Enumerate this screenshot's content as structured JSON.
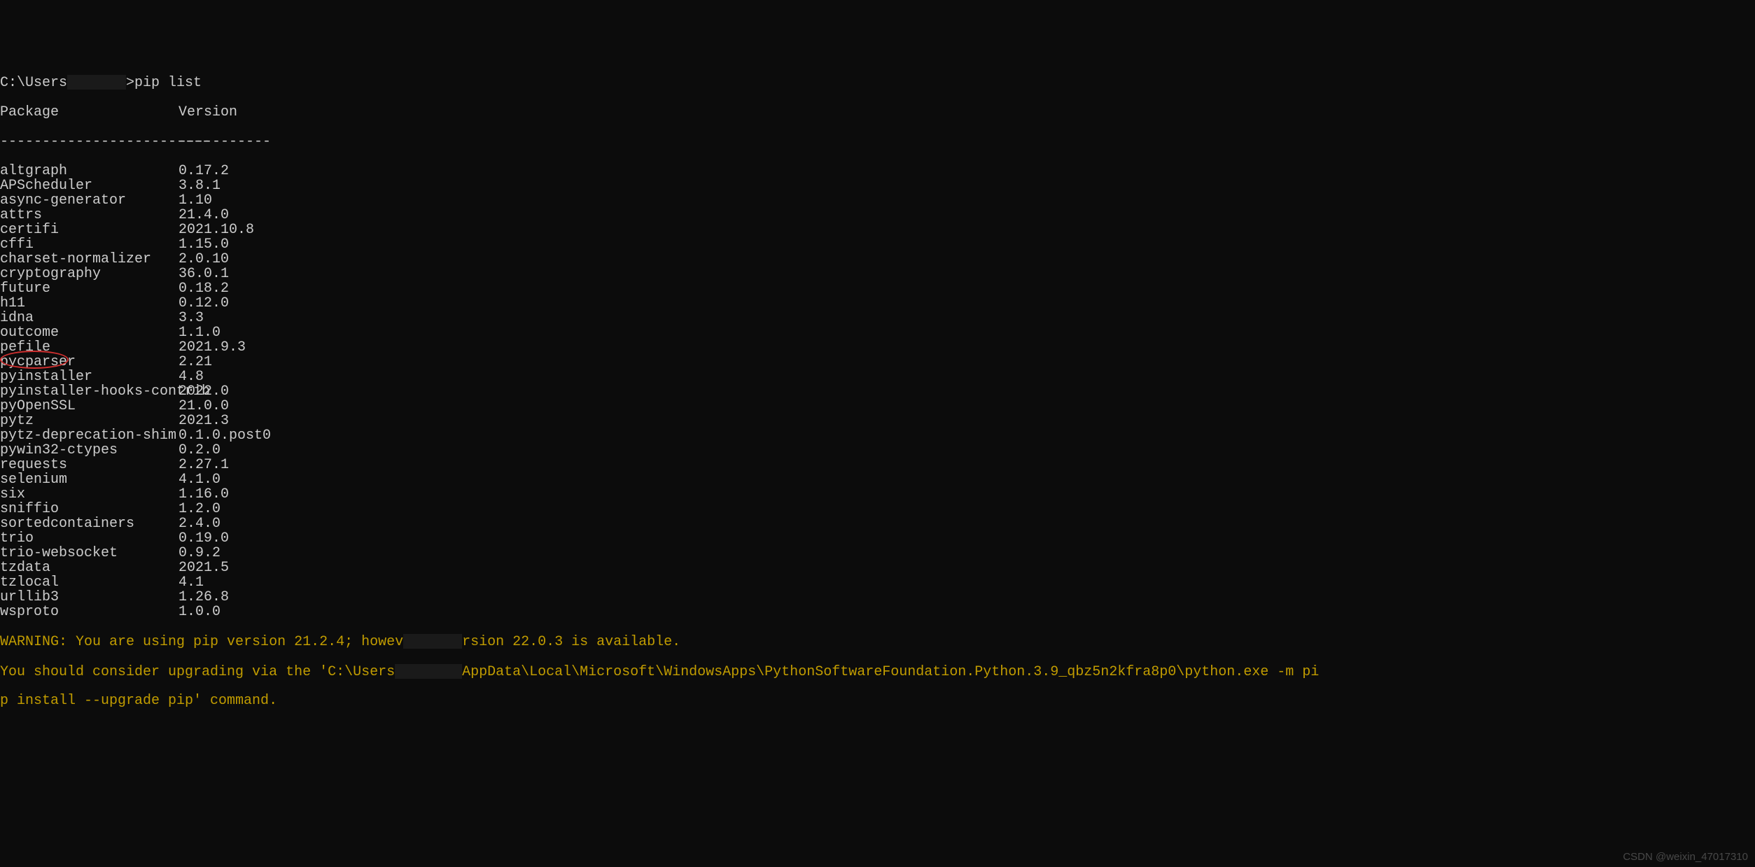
{
  "prompt": {
    "prefix": "C:\\Users",
    "redacted": "       ",
    "suffix": ">pip list"
  },
  "header": {
    "package": "Package",
    "version": "Version"
  },
  "divider": {
    "left": "-------------------------",
    "right": "-----------"
  },
  "packages": [
    {
      "name": "altgraph",
      "version": "0.17.2"
    },
    {
      "name": "APScheduler",
      "version": "3.8.1"
    },
    {
      "name": "async-generator",
      "version": "1.10"
    },
    {
      "name": "attrs",
      "version": "21.4.0"
    },
    {
      "name": "certifi",
      "version": "2021.10.8"
    },
    {
      "name": "cffi",
      "version": "1.15.0"
    },
    {
      "name": "charset-normalizer",
      "version": "2.0.10"
    },
    {
      "name": "cryptography",
      "version": "36.0.1"
    },
    {
      "name": "future",
      "version": "0.18.2"
    },
    {
      "name": "h11",
      "version": "0.12.0"
    },
    {
      "name": "idna",
      "version": "3.3"
    },
    {
      "name": "outcome",
      "version": "1.1.0"
    },
    {
      "name": "pefile",
      "version": "2021.9.3"
    },
    {
      "name": "pycparser",
      "version": "2.21"
    },
    {
      "name": "pyinstaller",
      "version": "4.8"
    },
    {
      "name": "pyinstaller-hooks-contrib",
      "version": "2022.0"
    },
    {
      "name": "pyOpenSSL",
      "version": "21.0.0"
    },
    {
      "name": "pytz",
      "version": "2021.3"
    },
    {
      "name": "pytz-deprecation-shim",
      "version": "0.1.0.post0"
    },
    {
      "name": "pywin32-ctypes",
      "version": "0.2.0"
    },
    {
      "name": "requests",
      "version": "2.27.1"
    },
    {
      "name": "selenium",
      "version": "4.1.0"
    },
    {
      "name": "six",
      "version": "1.16.0"
    },
    {
      "name": "sniffio",
      "version": "1.2.0"
    },
    {
      "name": "sortedcontainers",
      "version": "2.4.0"
    },
    {
      "name": "trio",
      "version": "0.19.0"
    },
    {
      "name": "trio-websocket",
      "version": "0.9.2"
    },
    {
      "name": "tzdata",
      "version": "2021.5"
    },
    {
      "name": "tzlocal",
      "version": "4.1"
    },
    {
      "name": "urllib3",
      "version": "1.26.8"
    },
    {
      "name": "wsproto",
      "version": "1.0.0"
    }
  ],
  "warning": {
    "line1_pre": "WARNING: You are using pip version 21.2.4; howev",
    "line1_redacted": "       ",
    "line1_post": "rsion 22.0.3 is available.",
    "line2_pre": "You should consider upgrading via the 'C:\\Users",
    "line2_redacted": "        ",
    "line2_post": "AppData\\Local\\Microsoft\\WindowsApps\\PythonSoftwareFoundation.Python.3.9_qbz5n2kfra8p0\\python.exe -m pi",
    "line3": "p install --upgrade pip' command."
  },
  "watermark": "CSDN @weixin_47017310"
}
